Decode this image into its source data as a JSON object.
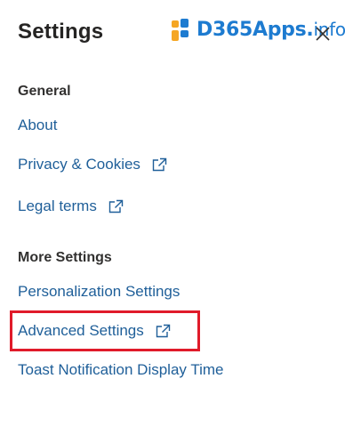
{
  "panel": {
    "title": "Settings",
    "close_icon": "close-icon"
  },
  "watermark": {
    "brand": "D365Apps.",
    "suffix": "info",
    "colors": {
      "text": "#1d7bd0",
      "square_orange": "#f5a623",
      "square_blue": "#1d7bd0"
    }
  },
  "sections": [
    {
      "heading": "General",
      "links": [
        {
          "label": "About",
          "external": false
        },
        {
          "label": "Privacy & Cookies",
          "external": true,
          "icon": "external-link-icon"
        },
        {
          "label": "Legal terms",
          "external": true,
          "icon": "external-link-icon"
        }
      ]
    },
    {
      "heading": "More Settings",
      "links": [
        {
          "label": "Personalization Settings",
          "external": false
        },
        {
          "label": "Advanced Settings",
          "external": true,
          "icon": "external-link-icon",
          "highlighted": true
        },
        {
          "label": "Toast Notification Display Time",
          "external": false
        }
      ]
    }
  ],
  "colors": {
    "link": "#1f5f99",
    "heading": "#323130",
    "highlight_border": "#e01b2a"
  }
}
